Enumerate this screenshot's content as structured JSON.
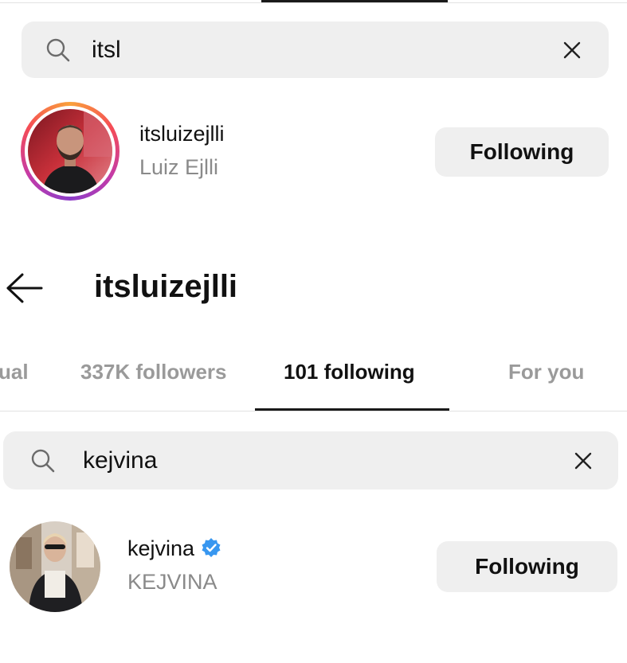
{
  "search_top": {
    "query": "itsl"
  },
  "result_top": {
    "username": "itsluizejlli",
    "full_name": "Luiz Ejlli",
    "button_label": "Following",
    "has_story_ring": true
  },
  "profile_header": {
    "title": "itsluizejlli"
  },
  "tabs": [
    {
      "label": "ual",
      "active": false
    },
    {
      "label": "337K followers",
      "active": false
    },
    {
      "label": "101 following",
      "active": true
    },
    {
      "label": "For you",
      "active": false
    }
  ],
  "search_bottom": {
    "query": "kejvina"
  },
  "result_bottom": {
    "username": "kejvina",
    "full_name": "KEJVINA",
    "verified": true,
    "button_label": "Following"
  },
  "colors": {
    "verified_blue": "#3897f0",
    "search_bg": "#efefef",
    "button_bg": "#efefef",
    "secondary_text": "#8a8a8a"
  },
  "icons": [
    "search-icon",
    "close-icon",
    "back-arrow-icon",
    "verified-badge-icon"
  ]
}
